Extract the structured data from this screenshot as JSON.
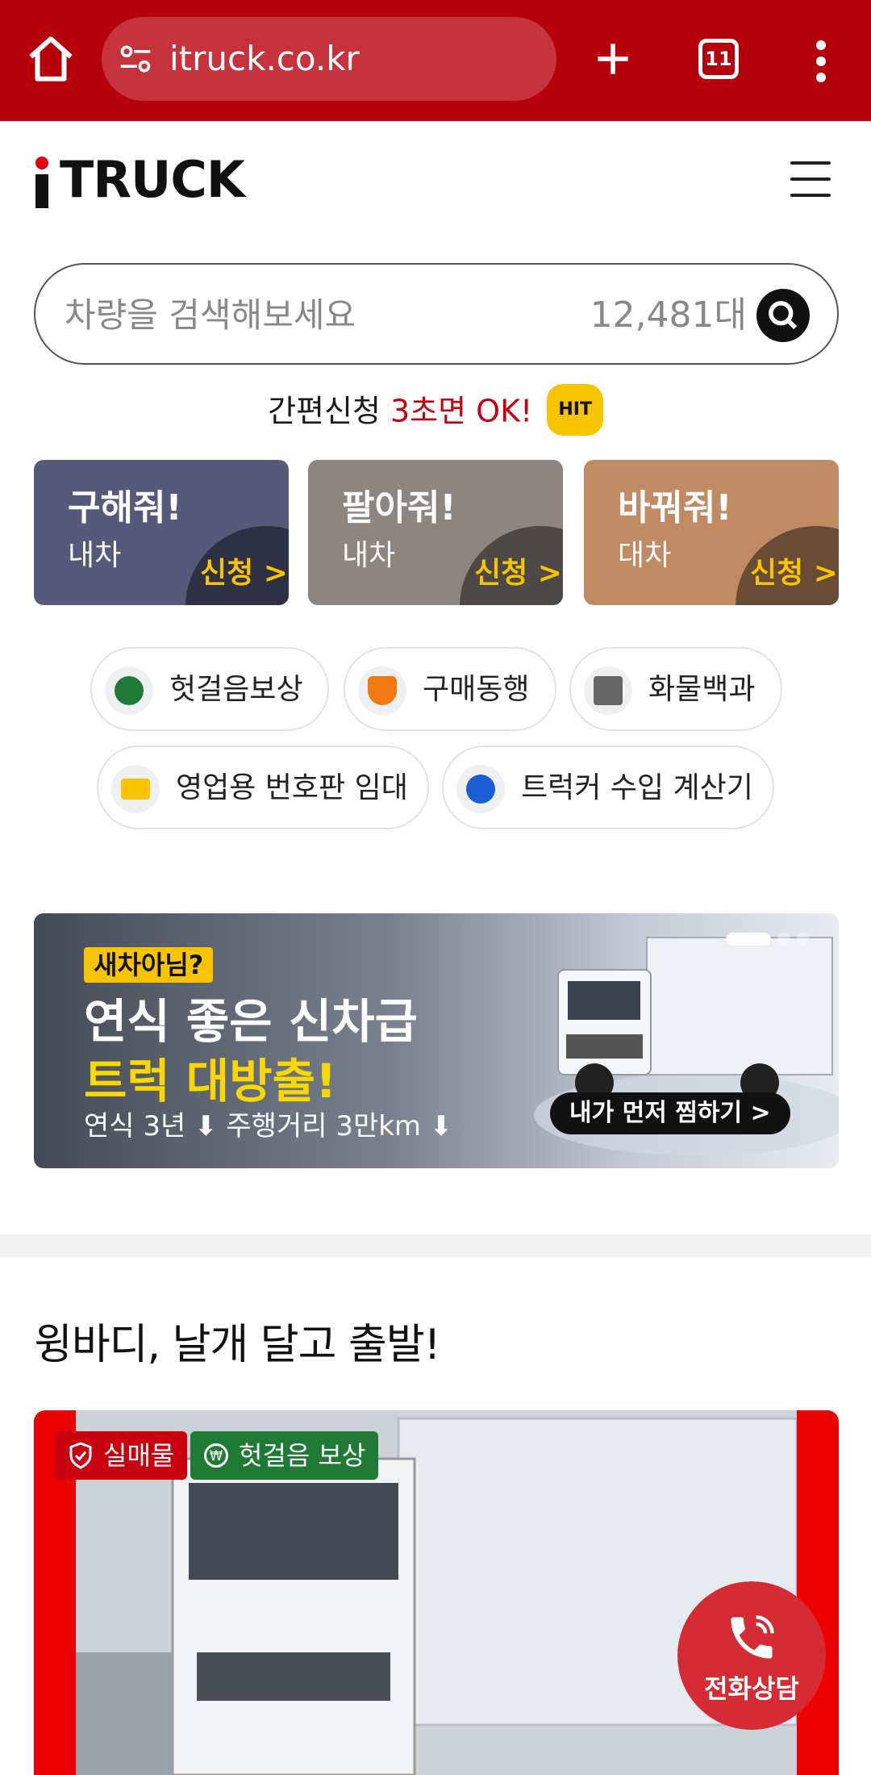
{
  "browser": {
    "url": "itruck.co.kr",
    "tab_count": "11"
  },
  "header": {
    "logo_text": "TRUCK"
  },
  "search": {
    "placeholder": "차량을 검색해보세요",
    "count": "12,481대"
  },
  "quick_apply": {
    "prefix": "간편신청 ",
    "highlight": "3초면 OK!",
    "badge": "HIT",
    "cards": [
      {
        "title": "구해줘!",
        "sub": "내차",
        "action": "신청 >",
        "color": "#555a7a"
      },
      {
        "title": "팔아줘!",
        "sub": "내차",
        "action": "신청 >",
        "color": "#8c8580"
      },
      {
        "title": "바꿔줘!",
        "sub": "대차",
        "action": "신청 >",
        "color": "#c08a62"
      }
    ]
  },
  "services": [
    {
      "label": "헛걸음보상",
      "icon": "won-refresh-icon"
    },
    {
      "label": "구매동행",
      "icon": "shield-plus-icon"
    },
    {
      "label": "화물백과",
      "icon": "book-icon"
    },
    {
      "label": "영업용 번호판 임대",
      "icon": "license-plate-icon"
    },
    {
      "label": "트럭커 수입 계산기",
      "icon": "won-coin-icon"
    }
  ],
  "banner": {
    "tag": "새차아님?",
    "headline1": "연식 좋은 신차급",
    "headline2": "트럭 대방출!",
    "sub1": "연식 3년",
    "sub2": "주행거리 3만km",
    "cta": "내가 먼저 찜하기 >"
  },
  "section": {
    "title": "윙바디, 날개 달고 출발!"
  },
  "listing": {
    "badges": [
      "실매물",
      "헛걸음 보상"
    ]
  },
  "fab": {
    "label": "전화상담"
  }
}
